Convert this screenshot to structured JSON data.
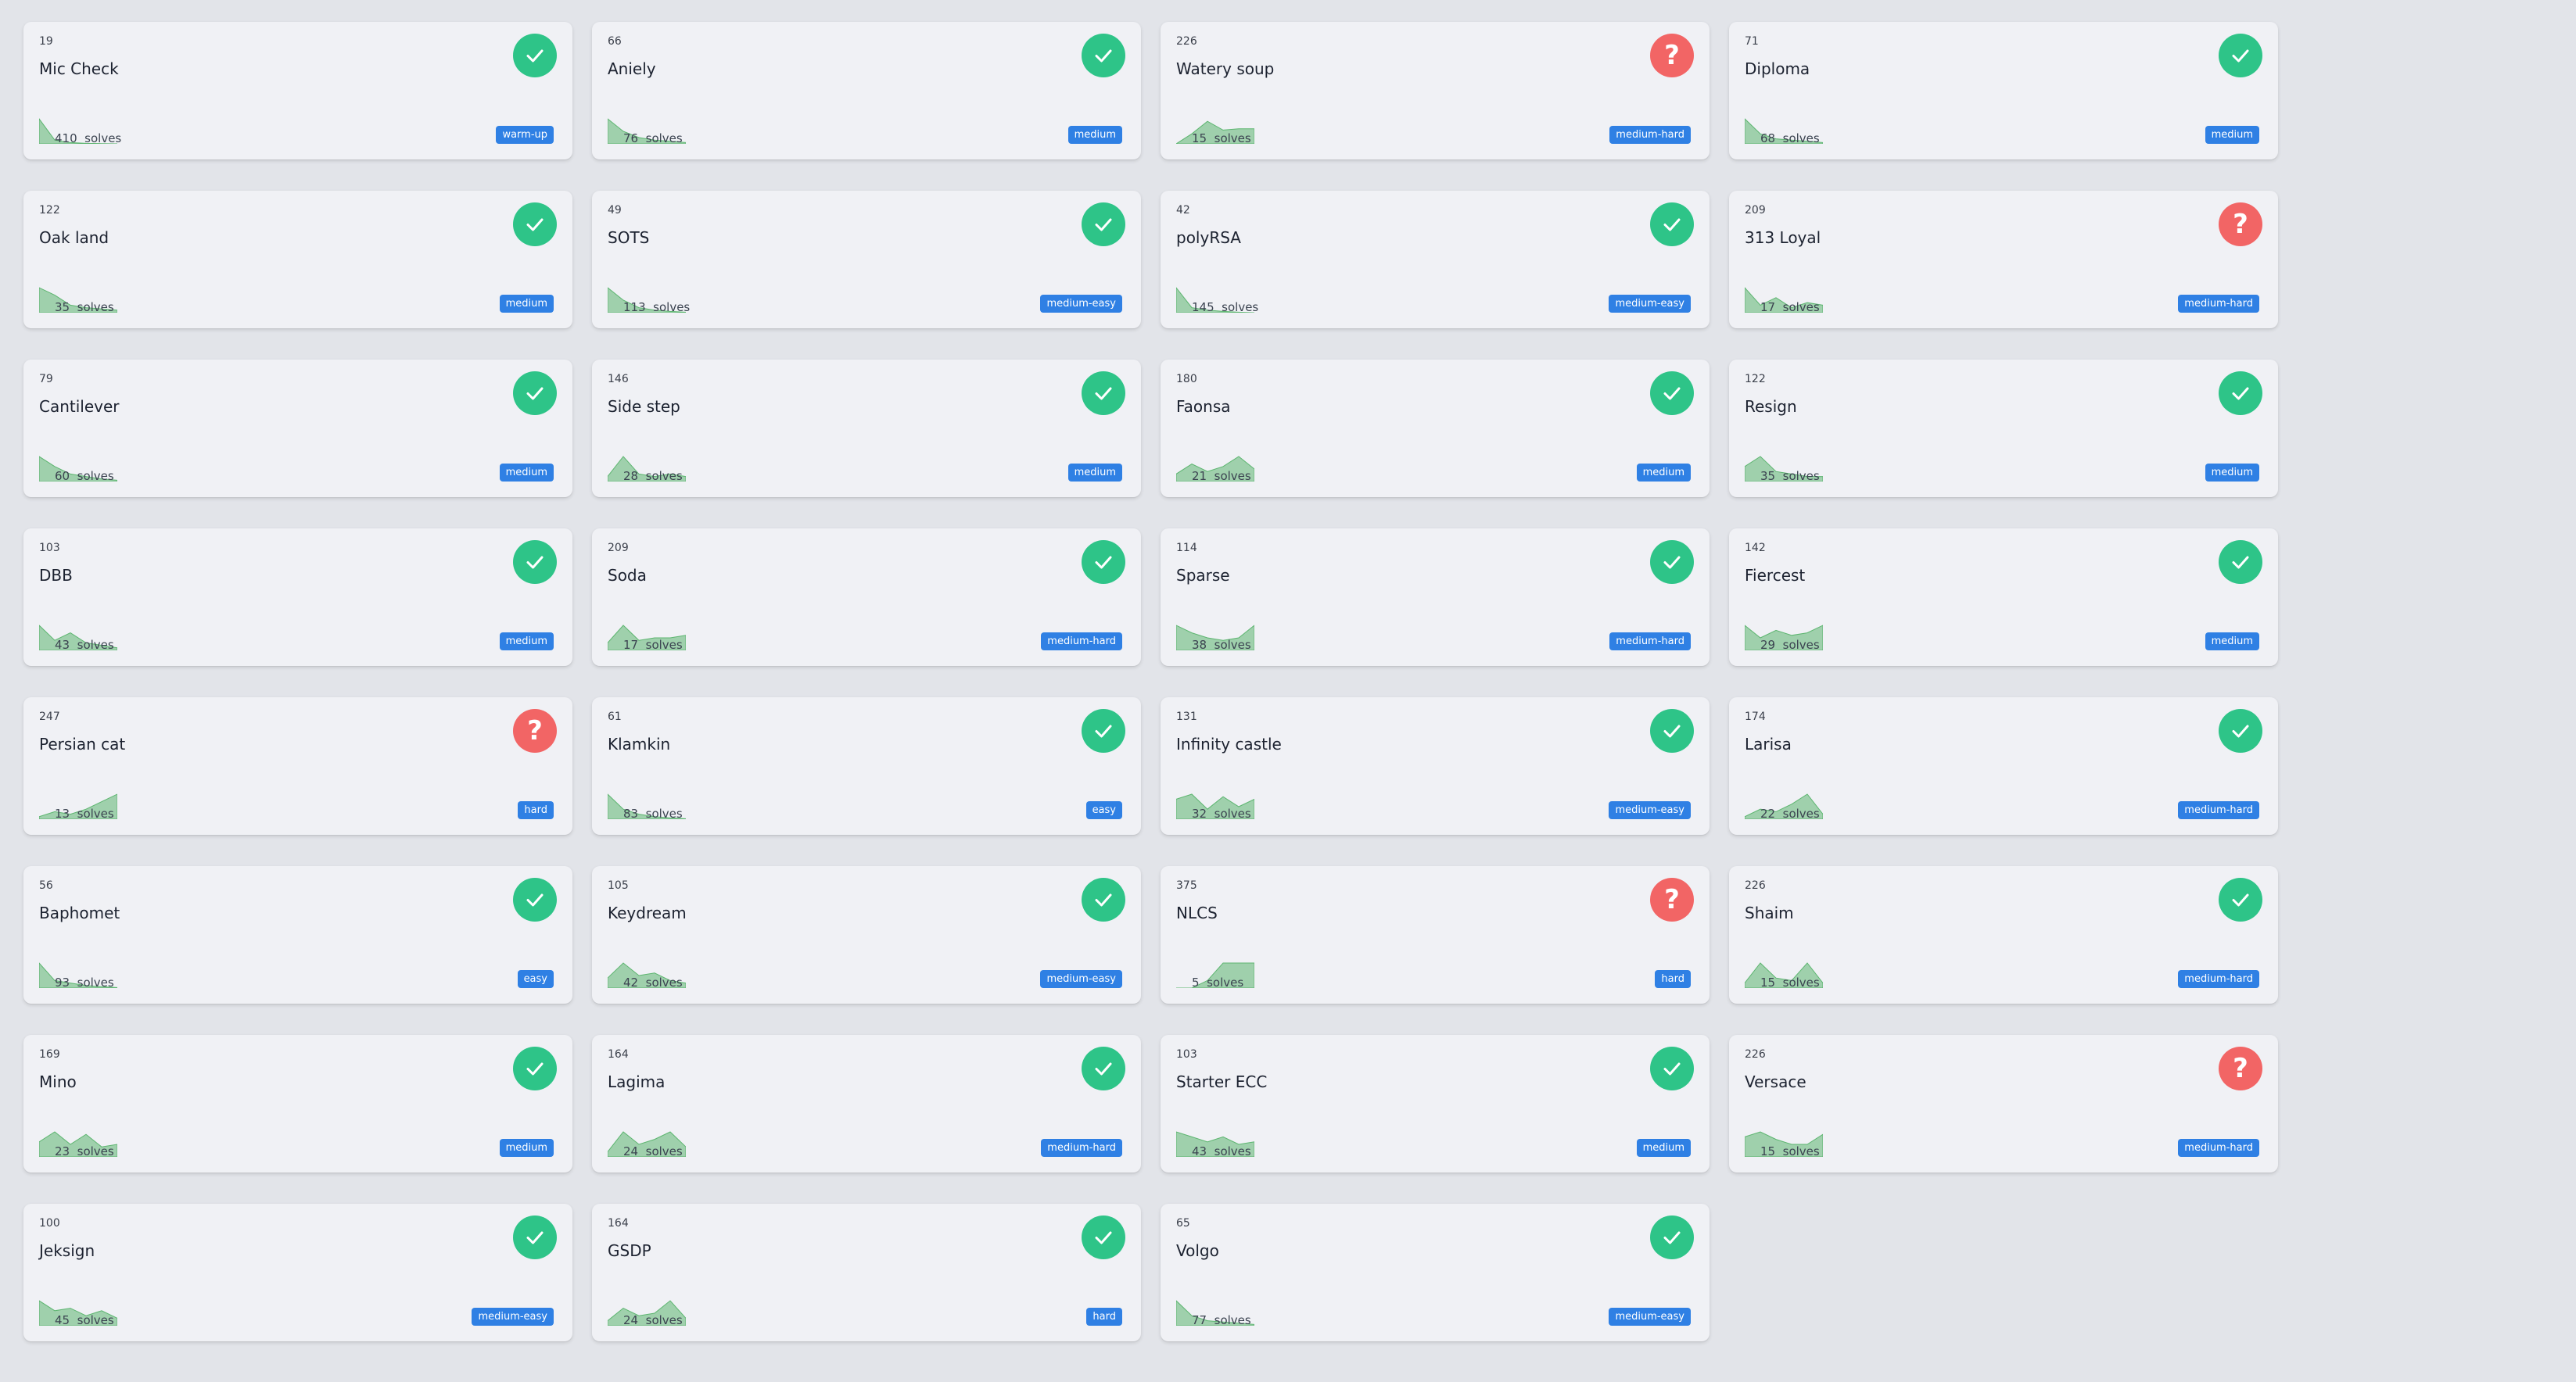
{
  "colors": {
    "background": "#e2e4e9",
    "card": "#f0f1f5",
    "solved": "#2ec488",
    "unsolved": "#f26565",
    "badge": "#2f80e4",
    "sparkline": "#5cb56f"
  },
  "solves_suffix": "solves",
  "challenges": [
    {
      "points": "19",
      "name": "Mic Check",
      "solves": "410",
      "difficulty": "warm-up",
      "status": "solved",
      "status_icon": "check-icon",
      "trend": [
        1.0,
        0.15,
        0.05,
        0.02,
        0.01,
        0.0
      ]
    },
    {
      "points": "66",
      "name": "Aniely",
      "solves": "76",
      "difficulty": "medium",
      "status": "solved",
      "status_icon": "check-icon",
      "trend": [
        1.0,
        0.5,
        0.25,
        0.15,
        0.1,
        0.05
      ]
    },
    {
      "points": "226",
      "name": "Watery soup",
      "solves": "15",
      "difficulty": "medium-hard",
      "status": "unsolved",
      "status_icon": "question-icon",
      "trend": [
        0.0,
        0.4,
        0.9,
        0.55,
        0.6,
        0.6
      ]
    },
    {
      "points": "71",
      "name": "Diploma",
      "solves": "68",
      "difficulty": "medium",
      "status": "solved",
      "status_icon": "check-icon",
      "trend": [
        1.0,
        0.4,
        0.2,
        0.15,
        0.1,
        0.05
      ]
    },
    {
      "points": "122",
      "name": "Oak land",
      "solves": "35",
      "difficulty": "medium",
      "status": "solved",
      "status_icon": "check-icon",
      "trend": [
        1.0,
        0.7,
        0.3,
        0.2,
        0.15,
        0.1
      ]
    },
    {
      "points": "49",
      "name": "SOTS",
      "solves": "113",
      "difficulty": "medium-easy",
      "status": "solved",
      "status_icon": "check-icon",
      "trend": [
        1.0,
        0.5,
        0.2,
        0.1,
        0.05,
        0.02
      ]
    },
    {
      "points": "42",
      "name": "polyRSA",
      "solves": "145",
      "difficulty": "medium-easy",
      "status": "solved",
      "status_icon": "check-icon",
      "trend": [
        1.0,
        0.2,
        0.1,
        0.05,
        0.02,
        0.0
      ]
    },
    {
      "points": "209",
      "name": "313 Loyal",
      "solves": "17",
      "difficulty": "medium-hard",
      "status": "unsolved",
      "status_icon": "question-icon",
      "trend": [
        1.0,
        0.3,
        0.6,
        0.2,
        0.4,
        0.3
      ]
    },
    {
      "points": "79",
      "name": "Cantilever",
      "solves": "60",
      "difficulty": "medium",
      "status": "solved",
      "status_icon": "check-icon",
      "trend": [
        1.0,
        0.6,
        0.3,
        0.2,
        0.1,
        0.05
      ]
    },
    {
      "points": "146",
      "name": "Side step",
      "solves": "28",
      "difficulty": "medium",
      "status": "solved",
      "status_icon": "check-icon",
      "trend": [
        0.2,
        1.0,
        0.3,
        0.2,
        0.3,
        0.2
      ]
    },
    {
      "points": "180",
      "name": "Faonsa",
      "solves": "21",
      "difficulty": "medium",
      "status": "solved",
      "status_icon": "check-icon",
      "trend": [
        0.3,
        0.7,
        0.4,
        0.6,
        1.0,
        0.5
      ]
    },
    {
      "points": "122",
      "name": "Resign",
      "solves": "35",
      "difficulty": "medium",
      "status": "solved",
      "status_icon": "check-icon",
      "trend": [
        0.6,
        1.0,
        0.4,
        0.3,
        0.2,
        0.2
      ]
    },
    {
      "points": "103",
      "name": "DBB",
      "solves": "43",
      "difficulty": "medium",
      "status": "solved",
      "status_icon": "check-icon",
      "trend": [
        1.0,
        0.4,
        0.7,
        0.3,
        0.2,
        0.1
      ]
    },
    {
      "points": "209",
      "name": "Soda",
      "solves": "17",
      "difficulty": "medium-hard",
      "status": "solved",
      "status_icon": "check-icon",
      "trend": [
        0.3,
        1.0,
        0.4,
        0.5,
        0.5,
        0.6
      ]
    },
    {
      "points": "114",
      "name": "Sparse",
      "solves": "38",
      "difficulty": "medium-hard",
      "status": "solved",
      "status_icon": "check-icon",
      "trend": [
        1.0,
        0.7,
        0.5,
        0.4,
        0.5,
        1.0
      ]
    },
    {
      "points": "142",
      "name": "Fiercest",
      "solves": "29",
      "difficulty": "medium",
      "status": "solved",
      "status_icon": "check-icon",
      "trend": [
        1.0,
        0.5,
        0.8,
        0.6,
        0.7,
        1.0
      ]
    },
    {
      "points": "247",
      "name": "Persian cat",
      "solves": "13",
      "difficulty": "hard",
      "status": "unsolved",
      "status_icon": "question-icon",
      "trend": [
        0.1,
        0.3,
        0.2,
        0.4,
        0.7,
        1.0
      ]
    },
    {
      "points": "61",
      "name": "Klamkin",
      "solves": "83",
      "difficulty": "easy",
      "status": "solved",
      "status_icon": "check-icon",
      "trend": [
        1.0,
        0.4,
        0.2,
        0.1,
        0.05,
        0.02
      ]
    },
    {
      "points": "131",
      "name": "Infinity castle",
      "solves": "32",
      "difficulty": "medium-easy",
      "status": "solved",
      "status_icon": "check-icon",
      "trend": [
        0.8,
        1.0,
        0.4,
        0.9,
        0.5,
        0.8
      ]
    },
    {
      "points": "174",
      "name": "Larisa",
      "solves": "22",
      "difficulty": "medium-hard",
      "status": "solved",
      "status_icon": "check-icon",
      "trend": [
        0.1,
        0.4,
        0.3,
        0.6,
        1.0,
        0.2
      ]
    },
    {
      "points": "56",
      "name": "Baphomet",
      "solves": "93",
      "difficulty": "easy",
      "status": "solved",
      "status_icon": "check-icon",
      "trend": [
        1.0,
        0.3,
        0.2,
        0.1,
        0.05,
        0.02
      ]
    },
    {
      "points": "105",
      "name": "Keydream",
      "solves": "42",
      "difficulty": "medium-easy",
      "status": "solved",
      "status_icon": "check-icon",
      "trend": [
        0.4,
        1.0,
        0.5,
        0.6,
        0.3,
        0.2
      ]
    },
    {
      "points": "375",
      "name": "NLCS",
      "solves": "5",
      "difficulty": "hard",
      "status": "unsolved",
      "status_icon": "question-icon",
      "trend": [
        0.0,
        0.0,
        0.3,
        1.0,
        1.0,
        1.0
      ]
    },
    {
      "points": "226",
      "name": "Shaim",
      "solves": "15",
      "difficulty": "medium-hard",
      "status": "solved",
      "status_icon": "check-icon",
      "trend": [
        0.2,
        1.0,
        0.4,
        0.3,
        1.0,
        0.2
      ]
    },
    {
      "points": "169",
      "name": "Mino",
      "solves": "23",
      "difficulty": "medium",
      "status": "solved",
      "status_icon": "check-icon",
      "trend": [
        0.6,
        1.0,
        0.5,
        0.9,
        0.4,
        0.5
      ]
    },
    {
      "points": "164",
      "name": "Lagima",
      "solves": "24",
      "difficulty": "medium-hard",
      "status": "solved",
      "status_icon": "check-icon",
      "trend": [
        0.2,
        1.0,
        0.5,
        0.7,
        1.0,
        0.4
      ]
    },
    {
      "points": "103",
      "name": "Starter ECC",
      "solves": "43",
      "difficulty": "medium",
      "status": "solved",
      "status_icon": "check-icon",
      "trend": [
        1.0,
        0.8,
        0.6,
        0.8,
        0.5,
        0.6
      ]
    },
    {
      "points": "226",
      "name": "Versace",
      "solves": "15",
      "difficulty": "medium-hard",
      "status": "unsolved",
      "status_icon": "question-icon",
      "trend": [
        0.8,
        1.0,
        0.7,
        0.5,
        0.5,
        0.9
      ]
    },
    {
      "points": "100",
      "name": "Jeksign",
      "solves": "45",
      "difficulty": "medium-easy",
      "status": "solved",
      "status_icon": "check-icon",
      "trend": [
        1.0,
        0.6,
        0.7,
        0.4,
        0.6,
        0.3
      ]
    },
    {
      "points": "164",
      "name": "GSDP",
      "solves": "24",
      "difficulty": "hard",
      "status": "solved",
      "status_icon": "check-icon",
      "trend": [
        0.2,
        0.7,
        0.4,
        0.5,
        1.0,
        0.3
      ]
    },
    {
      "points": "65",
      "name": "Volgo",
      "solves": "77",
      "difficulty": "medium-easy",
      "status": "solved",
      "status_icon": "check-icon",
      "trend": [
        1.0,
        0.4,
        0.2,
        0.15,
        0.1,
        0.05
      ]
    }
  ]
}
